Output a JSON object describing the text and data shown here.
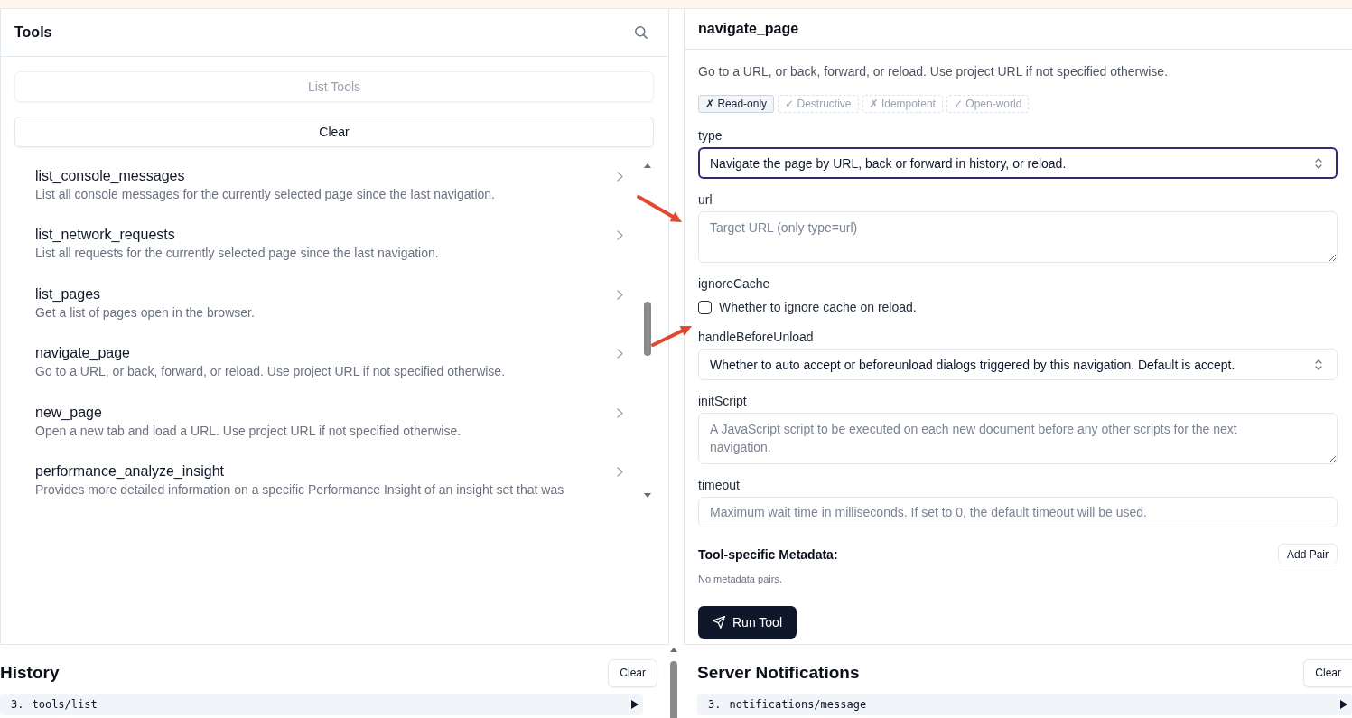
{
  "tools_panel": {
    "title": "Tools",
    "buttons": [
      {
        "label": "List Tools",
        "disabled": true
      },
      {
        "label": "Clear",
        "disabled": false
      }
    ],
    "items": [
      {
        "name": "list_console_messages",
        "description": "List all console messages for the currently selected page since the last navigation."
      },
      {
        "name": "list_network_requests",
        "description": "List all requests for the currently selected page since the last navigation."
      },
      {
        "name": "list_pages",
        "description": "Get a list of pages open in the browser."
      },
      {
        "name": "navigate_page",
        "description": "Go to a URL, or back, forward, or reload. Use project URL if not specified otherwise."
      },
      {
        "name": "new_page",
        "description": "Open a new tab and load a URL. Use project URL if not specified otherwise."
      },
      {
        "name": "performance_analyze_insight",
        "description": "Provides more detailed information on a specific Performance Insight of an insight set that was"
      }
    ]
  },
  "tool_detail": {
    "title": "navigate_page",
    "description": "Go to a URL, or back, forward, or reload. Use project URL if not specified otherwise.",
    "annotations": [
      {
        "label": "✗ Read-only",
        "active": true
      },
      {
        "label": "✓ Destructive",
        "active": false
      },
      {
        "label": "✗ Idempotent",
        "active": false
      },
      {
        "label": "✓ Open-world",
        "active": false
      }
    ],
    "fields": [
      {
        "kind": "select",
        "label": "type",
        "value": "Navigate the page by URL, back or forward in history, or reload.",
        "focused": true
      },
      {
        "kind": "textarea",
        "label": "url",
        "placeholder": "Target URL (only type=url)",
        "focused": false
      },
      {
        "kind": "checkbox",
        "label": "ignoreCache",
        "text": "Whether to ignore cache on reload.",
        "checked": false
      },
      {
        "kind": "select",
        "label": "handleBeforeUnload",
        "value": "Whether to auto accept or beforeunload dialogs triggered by this navigation. Default is accept.",
        "focused": false
      },
      {
        "kind": "textarea",
        "label": "initScript",
        "placeholder": "A JavaScript script to be executed on each new document before any other scripts for the next navigation.",
        "focused": false
      },
      {
        "kind": "input",
        "label": "timeout",
        "placeholder": "Maximum wait time in milliseconds. If set to 0, the default timeout will be used.",
        "focused": false
      }
    ],
    "metadata": {
      "title": "Tool-specific Metadata:",
      "add_button": "Add Pair",
      "empty_text": "No metadata pairs."
    },
    "run_button": "Run Tool"
  },
  "history": {
    "title": "History",
    "clear_button": "Clear",
    "entries": [
      {
        "index": "3.",
        "method": "tools/list",
        "expanded": false
      }
    ]
  },
  "notifications": {
    "title": "Server Notifications",
    "clear_button": "Clear",
    "entries": [
      {
        "index": "3.",
        "method": "notifications/message",
        "expanded": false
      }
    ]
  }
}
